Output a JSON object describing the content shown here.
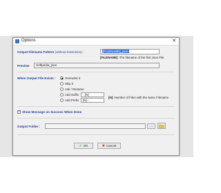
{
  "window": {
    "title": "Options",
    "close_glyph": "✕"
  },
  "output_filename": {
    "label": "Output Filename Pattern",
    "label_suffix": "(without Extension) :",
    "value": "[FILENAME]_json",
    "hint_token": "[FILENAME]",
    "hint_text": ": The filename of the first Json File"
  },
  "preview": {
    "label": "Preview",
    "value": "Softpedia_json"
  },
  "file_exists": {
    "label": "When Output File Exists :",
    "options": [
      {
        "label": "Overwrite it",
        "checked": true
      },
      {
        "label": "Skip it",
        "checked": false
      },
      {
        "label": "Ask / Rename",
        "checked": false
      },
      {
        "label": "Add Suffix",
        "checked": false
      },
      {
        "label": "Add Prefix",
        "checked": false
      }
    ],
    "suffix_value": "- [N]",
    "prefix_value": "[N] -",
    "n_token": "[N]",
    "n_hint": ": Number of Files with the same Filename"
  },
  "show_message": {
    "label": "Show Message on Success When Done",
    "checked": true
  },
  "output_folder": {
    "label": "Output Folder :",
    "value": "",
    "browse_label": "...",
    "folder_icon": "folder-icon"
  },
  "buttons": {
    "ok": "OK",
    "cancel": "Cancel"
  },
  "colors": {
    "label_blue": "#1a3f96",
    "selection": "#3a72d8",
    "ok_icon": "#2e9e3a",
    "cancel_icon": "#c8322b"
  }
}
